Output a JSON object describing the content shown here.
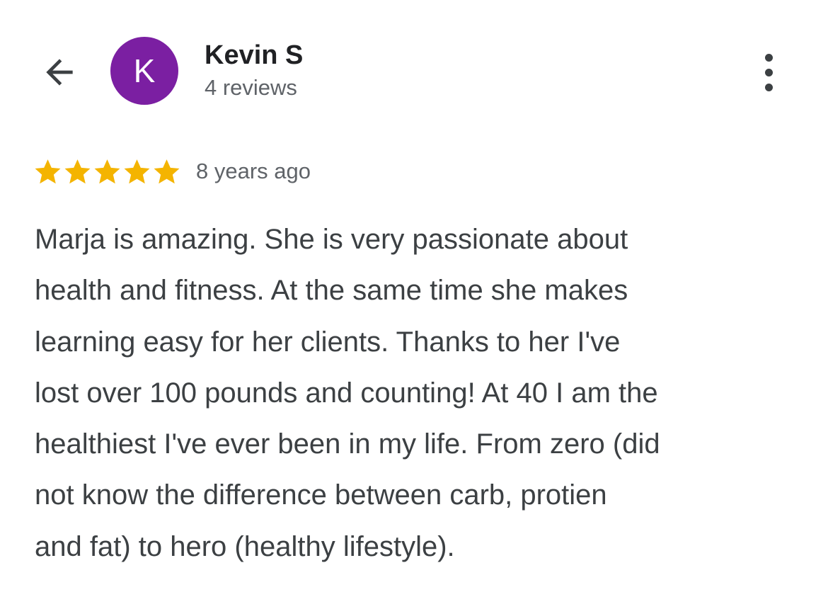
{
  "header": {
    "back_icon": "arrow-left-icon",
    "more_icon": "more-vert-icon",
    "author": {
      "initial": "K",
      "name": "Kevin S",
      "reviews_count": "4 reviews",
      "avatar_color": "#7b1fa2"
    }
  },
  "review": {
    "rating": 5,
    "max_rating": 5,
    "star_color": "#f4b400",
    "date": "8 years ago",
    "lines": [
      "Marja is amazing. She is very passionate about",
      "health and fitness. At the same time she makes",
      "learning easy for her clients. Thanks to her I've",
      "lost over 100 pounds and counting! At 40 I am the",
      "healthiest I've ever been in my life. From zero (did",
      "not know the difference between carb, protien",
      "and fat) to hero (healthy lifestyle)."
    ]
  }
}
